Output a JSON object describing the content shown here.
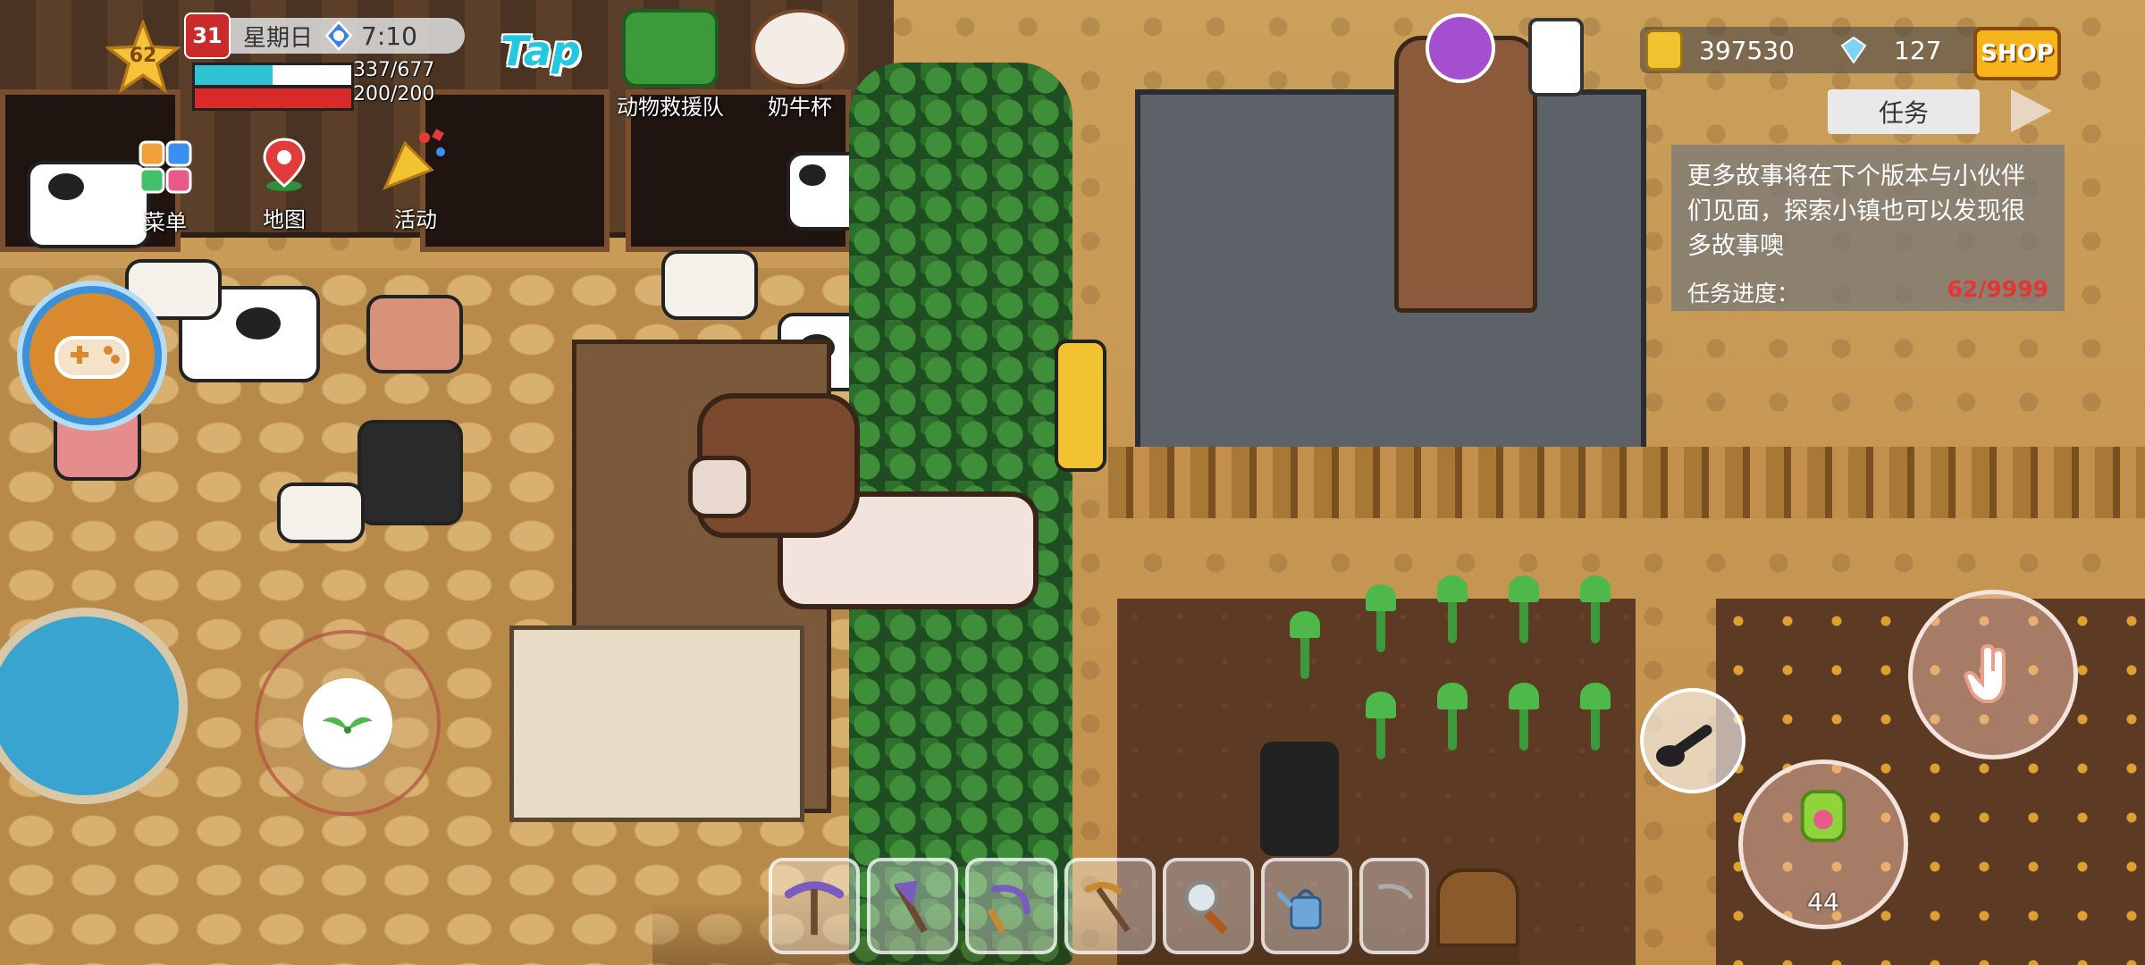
{
  "player": {
    "level": "62"
  },
  "datetime": {
    "calendar_icon_text": "31",
    "weekday": "星期日",
    "time": "7:10"
  },
  "stats": {
    "health_text": "337/677",
    "health_fraction": 0.4977,
    "energy_text": "200/200",
    "energy_fraction": 1.0,
    "health_color": "#2ec4d6",
    "energy_color": "#d92a2a"
  },
  "menu": {
    "menu_label": "菜单",
    "map_label": "地图",
    "activity_label": "活动",
    "taptap_logo": "Tap",
    "rescue_label": "动物救援队",
    "cup_label": "奶牛杯"
  },
  "currency": {
    "gold": "397530",
    "gems": "127",
    "shop_label": "SHOP"
  },
  "quest": {
    "tab_label": "任务",
    "description": "更多故事将在下个版本与小伙伴们见面，探索小镇也可以发现很多故事噢",
    "progress_label": "任务进度：",
    "progress_value": "62/9999"
  },
  "action": {
    "item_count": "44"
  },
  "hotbar": {
    "slots": [
      "pickaxe-icon",
      "axe-icon",
      "sickle-icon",
      "hoe-icon",
      "magnifier-icon",
      "watering-can-icon",
      "scythe-icon"
    ]
  },
  "colors": {
    "accent": "#f5b41c",
    "quest_progress": "#e53636"
  }
}
